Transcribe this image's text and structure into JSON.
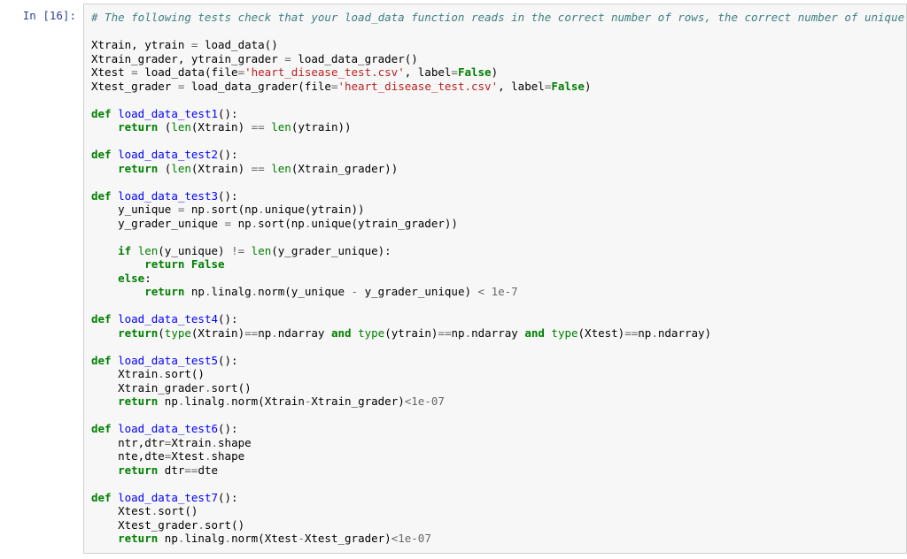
{
  "prompt": "In [16]:",
  "code": {
    "l01": "# The following tests check that your load_data function reads in the correct number of rows, the correct number of unique",
    "l02": "",
    "l03a": "Xtrain, ytrain ",
    "l03b": "=",
    "l03c": " load_data()",
    "l04a": "Xtrain_grader, ytrain_grader ",
    "l04b": "=",
    "l04c": " load_data_grader()",
    "l05a": "Xtest ",
    "l05b": "=",
    "l05c": " load_data(file",
    "l05d": "=",
    "l05e": "'heart_disease_test.csv'",
    "l05f": ", label",
    "l05g": "=",
    "l05h": "False",
    "l05i": ")",
    "l06a": "Xtest_grader ",
    "l06b": "=",
    "l06c": " load_data_grader(file",
    "l06d": "=",
    "l06e": "'heart_disease_test.csv'",
    "l06f": ", label",
    "l06g": "=",
    "l06h": "False",
    "l06i": ")",
    "l07": "",
    "d1a": "def",
    "d1b": " ",
    "d1c": "load_data_test1",
    "d1d": "():",
    "r1a": "    ",
    "r1b": "return",
    "r1c": " (",
    "r1d": "len",
    "r1e": "(Xtrain) ",
    "r1f": "==",
    "r1g": " ",
    "r1h": "len",
    "r1i": "(ytrain))",
    "l10": "",
    "d2a": "def",
    "d2b": " ",
    "d2c": "load_data_test2",
    "d2d": "():",
    "r2a": "    ",
    "r2b": "return",
    "r2c": " (",
    "r2d": "len",
    "r2e": "(Xtrain) ",
    "r2f": "==",
    "r2g": " ",
    "r2h": "len",
    "r2i": "(Xtrain_grader))",
    "l13": "",
    "d3a": "def",
    "d3b": " ",
    "d3c": "load_data_test3",
    "d3d": "():",
    "t3a": "    y_unique ",
    "t3b": "=",
    "t3c": " np",
    "t3d": ".",
    "t3e": "sort(np",
    "t3f": ".",
    "t3g": "unique(ytrain))",
    "t4a": "    y_grader_unique ",
    "t4b": "=",
    "t4c": " np",
    "t4d": ".",
    "t4e": "sort(np",
    "t4f": ".",
    "t4g": "unique(ytrain_grader))",
    "l17": "    ",
    "i1a": "    ",
    "i1b": "if",
    "i1c": " ",
    "i1d": "len",
    "i1e": "(y_unique) ",
    "i1f": "!=",
    "i1g": " ",
    "i1h": "len",
    "i1i": "(y_grader_unique):",
    "i2a": "        ",
    "i2b": "return",
    "i2c": " ",
    "i2d": "False",
    "e1a": "    ",
    "e1b": "else",
    "e1c": ":",
    "e2a": "        ",
    "e2b": "return",
    "e2c": " np",
    "e2d": ".",
    "e2e": "linalg",
    "e2f": ".",
    "e2g": "norm(y_unique ",
    "e2h": "-",
    "e2i": " y_grader_unique) ",
    "e2j": "<",
    "e2k": " ",
    "e2l": "1e-7",
    "l22": "",
    "d4a": "def",
    "d4b": " ",
    "d4c": "load_data_test4",
    "d4d": "():",
    "r4a": "    ",
    "r4b": "return",
    "r4c": "(",
    "r4d": "type",
    "r4e": "(Xtrain)",
    "r4f": "==",
    "r4g": "np",
    "r4h": ".",
    "r4i": "ndarray ",
    "r4j": "and",
    "r4k": " ",
    "r4l": "type",
    "r4m": "(ytrain)",
    "r4n": "==",
    "r4o": "np",
    "r4p": ".",
    "r4q": "ndarray ",
    "r4r": "and",
    "r4s": " ",
    "r4t": "type",
    "r4u": "(Xtest)",
    "r4v": "==",
    "r4w": "np",
    "r4x": ".",
    "r4y": "ndarray)",
    "l25": "",
    "d5a": "def",
    "d5b": " ",
    "d5c": "load_data_test5",
    "d5d": "():",
    "s5a": "    Xtrain",
    "s5b": ".",
    "s5c": "sort()",
    "s6a": "    Xtrain_grader",
    "s6b": ".",
    "s6c": "sort()",
    "r5a": "    ",
    "r5b": "return",
    "r5c": " np",
    "r5d": ".",
    "r5e": "linalg",
    "r5f": ".",
    "r5g": "norm(Xtrain",
    "r5h": "-",
    "r5i": "Xtrain_grader)",
    "r5j": "<",
    "r5k": "1e-07",
    "l30": "",
    "d6a": "def",
    "d6b": " ",
    "d6c": "load_data_test6",
    "d6d": "():",
    "s7a": "    ntr,dtr",
    "s7b": "=",
    "s7c": "Xtrain",
    "s7d": ".",
    "s7e": "shape",
    "s8a": "    nte,dte",
    "s8b": "=",
    "s8c": "Xtest",
    "s8d": ".",
    "s8e": "shape",
    "r6a": "    ",
    "r6b": "return",
    "r6c": " dtr",
    "r6d": "==",
    "r6e": "dte",
    "l35": "",
    "d7a": "def",
    "d7b": " ",
    "d7c": "load_data_test7",
    "d7d": "():",
    "s9a": "    Xtest",
    "s9b": ".",
    "s9c": "sort()",
    "saa": "    Xtest_grader",
    "sab": ".",
    "sac": "sort()",
    "r7a": "    ",
    "r7b": "return",
    "r7c": " np",
    "r7d": ".",
    "r7e": "linalg",
    "r7f": ".",
    "r7g": "norm(Xtest",
    "r7h": "-",
    "r7i": "Xtest_grader)",
    "r7j": "<",
    "r7k": "1e-07"
  }
}
